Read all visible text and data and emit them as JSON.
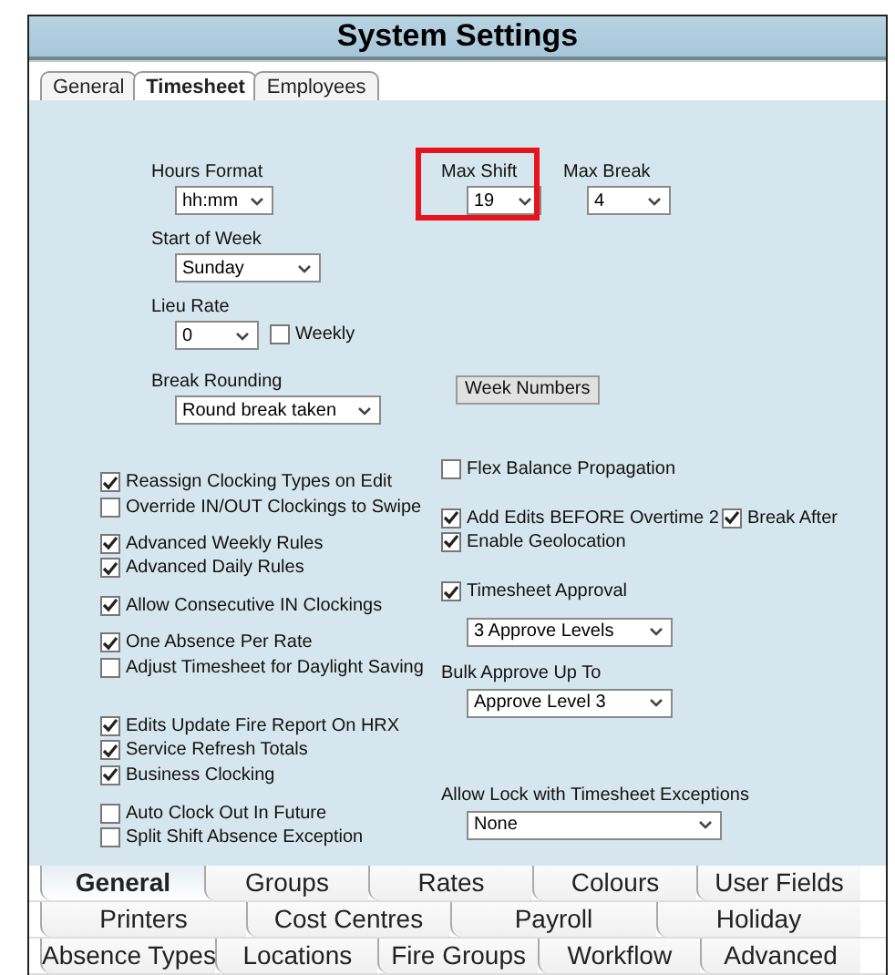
{
  "window": {
    "title": "System Settings"
  },
  "top_tabs": [
    {
      "label": "General",
      "selected": false
    },
    {
      "label": "Timesheet",
      "selected": true
    },
    {
      "label": "Employees",
      "selected": false
    }
  ],
  "hours_format": {
    "label": "Hours Format",
    "value": "hh:mm"
  },
  "start_of_week": {
    "label": "Start of Week",
    "value": "Sunday"
  },
  "lieu_rate": {
    "label": "Lieu Rate",
    "value": "0",
    "weekly": {
      "label": "Weekly",
      "checked": false
    }
  },
  "break_rounding": {
    "label": "Break Rounding",
    "value": "Round break taken"
  },
  "week_numbers_button": "Week Numbers",
  "max_shift": {
    "label": "Max Shift",
    "value": "19",
    "highlighted": true
  },
  "max_break": {
    "label": "Max Break",
    "value": "4"
  },
  "left_options": [
    {
      "items": [
        {
          "label": "Reassign Clocking Types on Edit",
          "checked": true
        },
        {
          "label": "Override IN/OUT Clockings to Swipe",
          "checked": false
        }
      ]
    },
    {
      "items": [
        {
          "label": "Advanced Weekly Rules",
          "checked": true
        },
        {
          "label": "Advanced Daily Rules",
          "checked": true
        }
      ]
    },
    {
      "items": [
        {
          "label": "Allow Consecutive IN Clockings",
          "checked": true
        }
      ]
    },
    {
      "items": [
        {
          "label": "One Absence Per Rate",
          "checked": true
        },
        {
          "label": "Adjust Timesheet for Daylight Saving",
          "checked": false
        }
      ]
    },
    {
      "items": [
        {
          "label": "Edits Update Fire Report On HRX",
          "checked": true
        },
        {
          "label": "Service Refresh Totals",
          "checked": true
        },
        {
          "label": "Business Clocking",
          "checked": true
        }
      ]
    },
    {
      "items": [
        {
          "label": "Auto Clock Out In Future",
          "checked": false
        },
        {
          "label": "Split Shift Absence Exception",
          "checked": false
        }
      ]
    }
  ],
  "right_options": [
    {
      "kind": "checkbox",
      "label": "Flex Balance Propagation",
      "checked": false
    },
    {
      "kind": "checkbox_pair",
      "items": [
        {
          "label": "Add Edits BEFORE Overtime 2",
          "checked": true
        },
        {
          "label": "Break After",
          "checked": true
        }
      ]
    },
    {
      "kind": "checkbox",
      "label": "Enable Geolocation",
      "checked": true
    },
    {
      "kind": "checkbox",
      "label": "Timesheet Approval",
      "checked": true
    },
    {
      "kind": "select",
      "value": "3 Approve Levels"
    },
    {
      "kind": "label",
      "text": "Bulk Approve Up To"
    },
    {
      "kind": "select",
      "value": "Approve Level 3"
    },
    {
      "kind": "label",
      "text": "Allow Lock with Timesheet Exceptions"
    },
    {
      "kind": "select",
      "value": "None",
      "wide": true
    }
  ],
  "bottom_tabs": [
    {
      "tabs": [
        {
          "label": "General",
          "selected": true
        },
        {
          "label": "Groups",
          "selected": false
        },
        {
          "label": "Rates",
          "selected": false
        },
        {
          "label": "Colours",
          "selected": false
        },
        {
          "label": "User Fields",
          "selected": false
        }
      ]
    },
    {
      "tabs": [
        {
          "label": "Printers",
          "selected": false
        },
        {
          "label": "Cost Centres",
          "selected": false
        },
        {
          "label": "Payroll",
          "selected": false
        },
        {
          "label": "Holiday",
          "selected": false
        }
      ]
    },
    {
      "tabs": [
        {
          "label": "Absence Types",
          "selected": false
        },
        {
          "label": "Locations",
          "selected": false
        },
        {
          "label": "Fire Groups",
          "selected": false
        },
        {
          "label": "Workflow",
          "selected": false
        },
        {
          "label": "Advanced",
          "selected": false
        }
      ]
    }
  ]
}
